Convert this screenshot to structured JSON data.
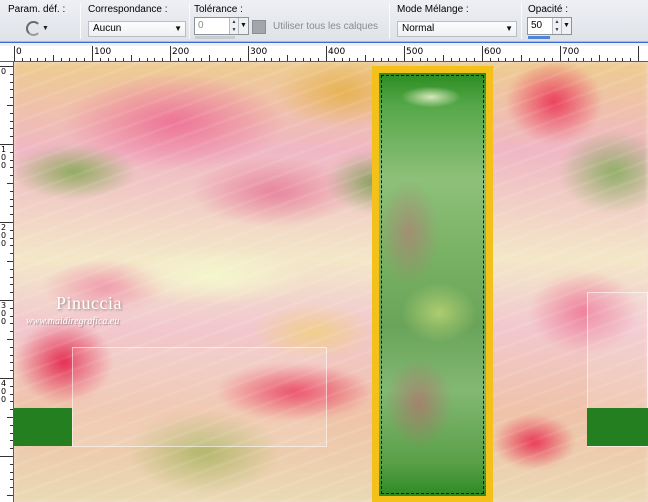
{
  "toolbar": {
    "preset": {
      "label": "Param. déf. :",
      "icon": "swirl-preset-icon"
    },
    "match_mode": {
      "label": "Correspondance :",
      "value": "Aucun"
    },
    "tolerance": {
      "label": "Tolérance :",
      "value": "0"
    },
    "all_layers": {
      "label": "Utiliser tous les calques",
      "checked": false,
      "enabled": false
    },
    "blend_mode": {
      "label": "Mode Mélange :",
      "value": "Normal"
    },
    "opacity": {
      "label": "Opacité :",
      "value": "50"
    }
  },
  "ruler": {
    "horizontal_labels": [
      "0",
      "100",
      "200",
      "300",
      "400",
      "500",
      "600",
      "700"
    ],
    "vertical_labels": [
      "0",
      "100",
      "200",
      "300",
      "400"
    ]
  },
  "canvas": {
    "watermark_name": "Pinuccia",
    "watermark_url": "www.maidiregrafica.eu",
    "selection_color": "#f4c01a",
    "accent_green": "#237f1f"
  }
}
